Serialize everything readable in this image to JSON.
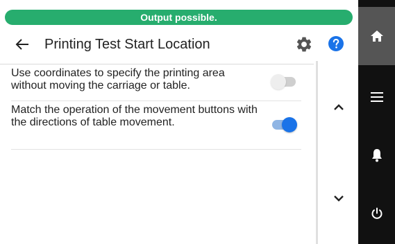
{
  "status": {
    "text": "Output possible.",
    "color": "#27ad6e"
  },
  "header": {
    "title": "Printing Test Start Location",
    "back_icon": "arrow-left-icon",
    "settings_icon": "gear-icon",
    "help_icon": "help-circle-icon"
  },
  "settings": [
    {
      "label": "Use coordinates to specify the printing area without moving the carriage or table.",
      "enabled": false
    },
    {
      "label": "Match the operation of the movement buttons with the directions of table movement.",
      "enabled": true
    }
  ],
  "scroll": {
    "up_icon": "chevron-up-icon",
    "down_icon": "chevron-down-icon"
  },
  "sidebar": {
    "items": [
      {
        "icon": "home-icon"
      },
      {
        "icon": "menu-icon"
      },
      {
        "icon": "bell-icon"
      },
      {
        "icon": "power-icon"
      }
    ]
  },
  "colors": {
    "accent": "#1a73e8",
    "sidebar_bg": "#111111",
    "sidebar_active": "#555555"
  }
}
